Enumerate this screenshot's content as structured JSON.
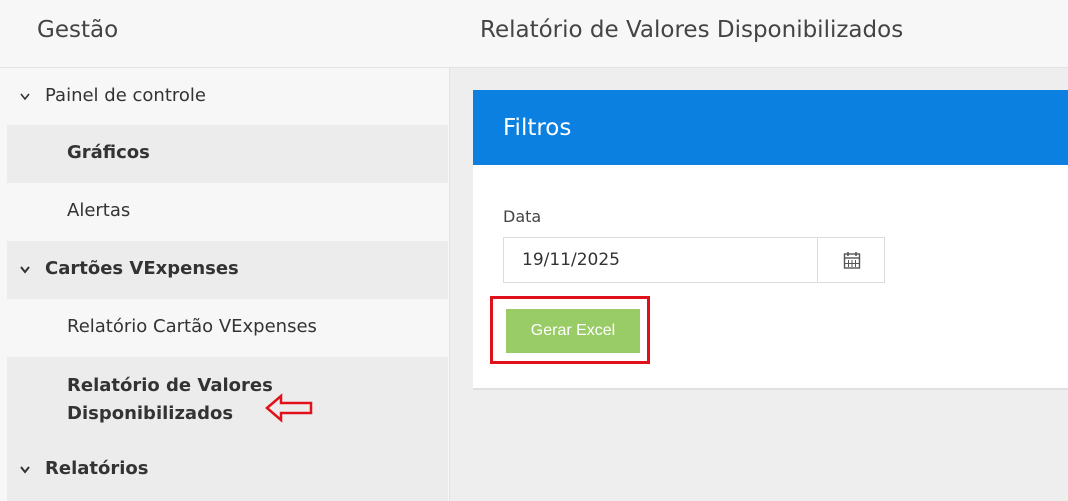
{
  "header": {
    "brand": "Gestão",
    "page_title": "Relatório de Valores Disponibilizados"
  },
  "sidebar": {
    "items": [
      {
        "label": "Painel de controle",
        "chevron": "chevron-down-icon"
      },
      {
        "label": "Gráficos"
      },
      {
        "label": "Alertas"
      },
      {
        "label": "Cartões VExpenses",
        "chevron": "chevron-down-icon"
      },
      {
        "label": "Relatório Cartão VExpenses"
      },
      {
        "label_line1": "Relatório de Valores",
        "label_line2": "Disponibilizados"
      },
      {
        "label": "Relatórios",
        "chevron": "chevron-down-icon"
      }
    ]
  },
  "filters": {
    "title": "Filtros",
    "date_label": "Data",
    "date_value": "19/11/2025",
    "calendar_icon": "calendar-icon",
    "excel_button": "Gerar Excel"
  },
  "colors": {
    "header_blue": "#0b80e0",
    "excel_green": "#99cc66",
    "highlight_red": "#e0111b"
  }
}
